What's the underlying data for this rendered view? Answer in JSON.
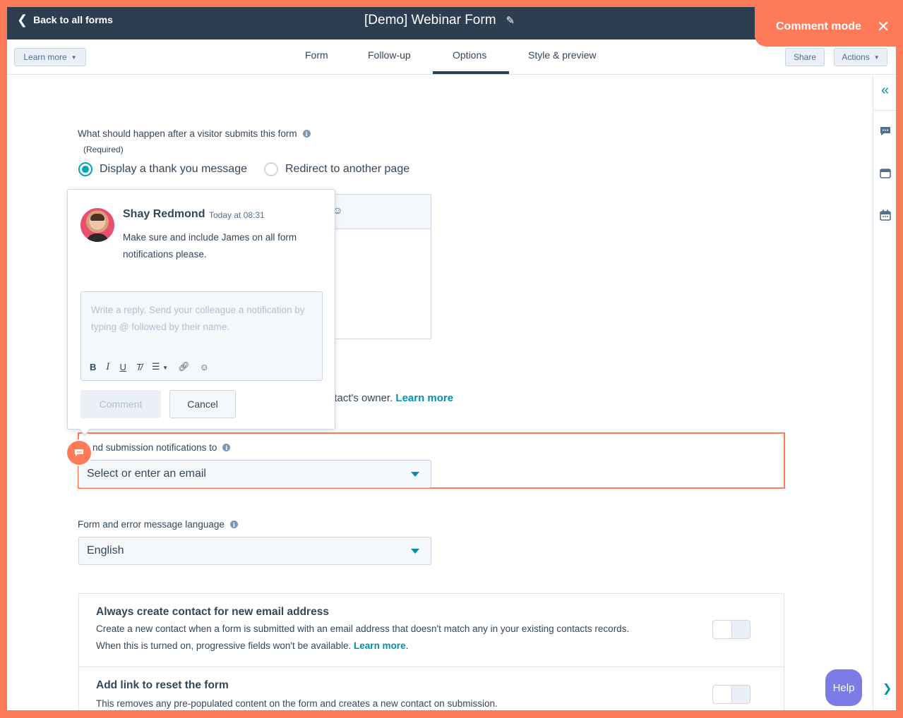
{
  "header": {
    "back_label": "Back to all forms",
    "title": "[Demo] Webinar Form",
    "comment_mode_label": "Comment mode"
  },
  "tabbar": {
    "learn_more_label": "Learn more",
    "tabs": [
      {
        "label": "Form"
      },
      {
        "label": "Follow-up"
      },
      {
        "label": "Options",
        "active": true
      },
      {
        "label": "Style & preview"
      }
    ],
    "share_label": "Share",
    "actions_label": "Actions"
  },
  "options": {
    "after_submit_label": "What should happen after a visitor submits this form",
    "required_label": "(Required)",
    "radio_thank_you": "Display a thank you message",
    "radio_redirect": "Redirect to another page",
    "owner_text": "ntact's owner.",
    "owner_learn_more": "Learn more",
    "notifications_label": "nd submission notifications to",
    "notifications_placeholder": "Select or enter an email",
    "language_label": "Form and error message language",
    "language_value": "English"
  },
  "comment": {
    "author": "Shay Redmond",
    "timestamp": "Today at 08:31",
    "body": "Make sure and include James on all form notifications please.",
    "reply_placeholder": "Write a reply. Send your colleague a notification by typing @ followed by their name.",
    "comment_button": "Comment",
    "cancel_button": "Cancel"
  },
  "settings": {
    "always_create_title": "Always create contact for new email address",
    "always_create_desc": "Create a new contact when a form is submitted with an email address that doesn't match any in your existing contacts records. When this is turned on, progressive fields won't be available.",
    "always_create_learn_more": "Learn more",
    "reset_title": "Add link to reset the form",
    "reset_desc": "This removes any pre-populated content on the form and creates a new contact on submission."
  },
  "help_label": "Help",
  "colors": {
    "accent": "#ff7a59",
    "header_bg": "#2d3e50",
    "link": "#0091ae",
    "help": "#7c7ce6"
  }
}
